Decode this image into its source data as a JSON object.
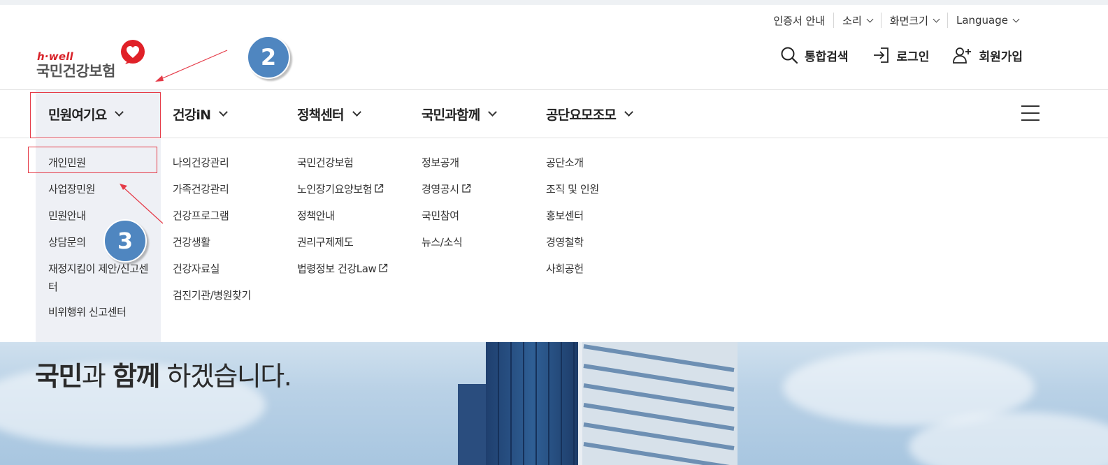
{
  "utility": {
    "items": [
      "인증서 안내",
      "소리",
      "화면크기",
      "Language"
    ]
  },
  "logo": {
    "tag": "h·well",
    "name": "국민건강보험"
  },
  "actions": {
    "search": "통합검색",
    "login": "로그인",
    "signup": "회원가입"
  },
  "annotations": {
    "badge_2": "2",
    "badge_3": "3"
  },
  "gnb": {
    "items": [
      "민원여기요",
      "건강iN",
      "정책센터",
      "국민과함께",
      "공단요모조모"
    ]
  },
  "mega": {
    "col1": [
      "개인민원",
      "사업장민원",
      "민원안내",
      "상담문의",
      "재정지킴이 제안/신고센터",
      "비위행위 신고센터"
    ],
    "col2": [
      "나의건강관리",
      "가족건강관리",
      "건강프로그램",
      "건강생활",
      "건강자료실",
      "검진기관/병원찾기"
    ],
    "col3": [
      "국민건강보험",
      "노인장기요양보험",
      "정책안내",
      "권리구제제도",
      "법령정보 건강Law"
    ],
    "col4": [
      "정보공개",
      "경영공시",
      "국민참여",
      "뉴스/소식"
    ],
    "col5": [
      "공단소개",
      "조직 및 인원",
      "홍보센터",
      "경영철학",
      "사회공헌"
    ]
  },
  "hero": {
    "tagline_1": "국민",
    "tagline_2": "과 ",
    "tagline_3": "함께",
    "tagline_4": " 하겠습니다."
  },
  "colors": {
    "accent": "#d8232a",
    "annotation": "#e53b48",
    "badge": "#4f86c0",
    "active_bg": "#eef0f5"
  }
}
